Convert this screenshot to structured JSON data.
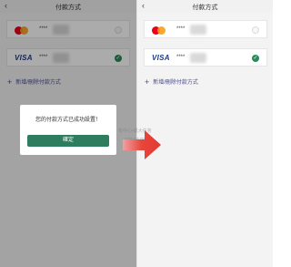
{
  "left_screen": {
    "header": {
      "back_icon": "chevron-left-icon",
      "title": "付款方式"
    },
    "cards": [
      {
        "brand": "mastercard",
        "number": "****",
        "selected": false
      },
      {
        "brand": "VISA",
        "number": "****",
        "selected": true
      }
    ],
    "add_label": "新增/刪除付款方式",
    "dialog": {
      "message": "您的付款方式已成功設置！",
      "confirm_label": "確定"
    }
  },
  "right_screen": {
    "header": {
      "back_icon": "chevron-left-icon",
      "title": "付款方式"
    },
    "cards": [
      {
        "brand": "mastercard",
        "number": "****",
        "selected": false
      },
      {
        "brand": "VISA",
        "number": "****",
        "selected": true
      }
    ],
    "add_label": "新增/刪除付款方式"
  },
  "watermark": {
    "line1": "有中心•成大任务",
    "line2": "www.ckk.me"
  },
  "colors": {
    "accent_green": "#2f7d5f",
    "arrow_red": "#e8453c",
    "link_purple": "#4a4a9a"
  }
}
